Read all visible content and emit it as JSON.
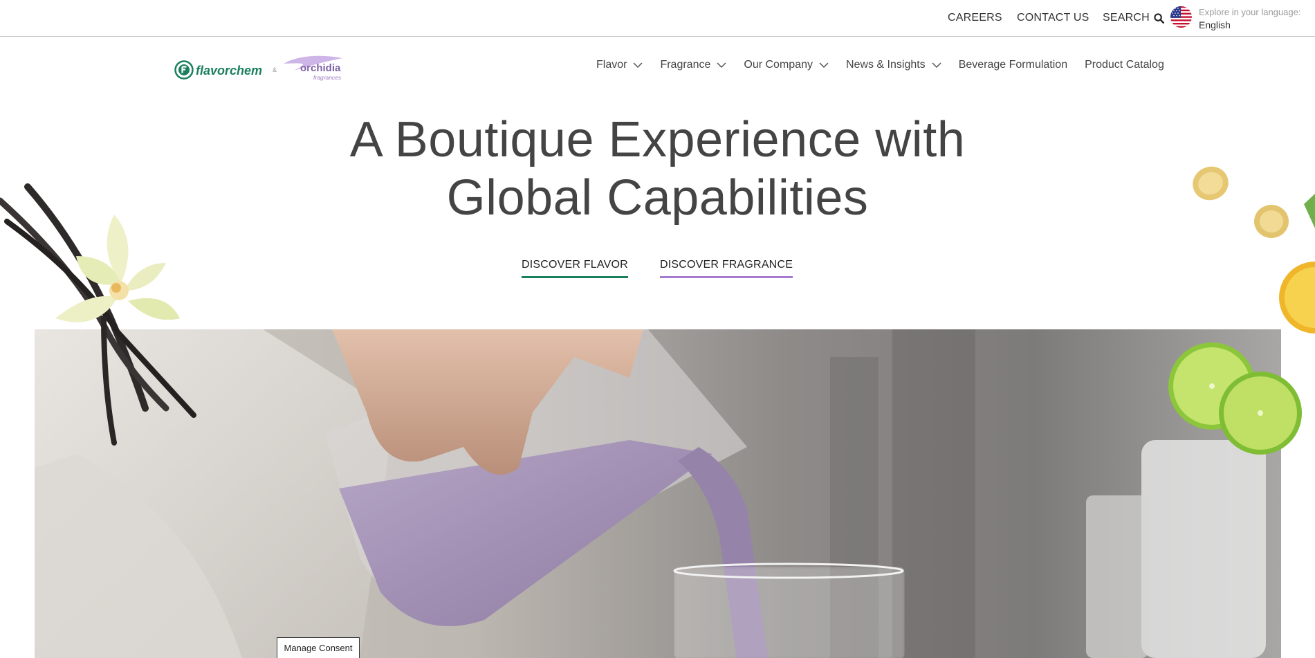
{
  "utility": {
    "careers": "CAREERS",
    "contact": "CONTACT US",
    "search": "SEARCH",
    "language_prompt": "Explore in your language:",
    "language_value": "English"
  },
  "logo": {
    "brand1": "flavorchem",
    "amp": "&",
    "brand2": "orchidia",
    "brand2_sub": "fragrances"
  },
  "nav": {
    "items": [
      {
        "label": "Flavor",
        "dropdown": true
      },
      {
        "label": "Fragrance",
        "dropdown": true
      },
      {
        "label": "Our Company",
        "dropdown": true
      },
      {
        "label": "News & Insights",
        "dropdown": true
      },
      {
        "label": "Beverage Formulation",
        "dropdown": false
      },
      {
        "label": "Product Catalog",
        "dropdown": false
      }
    ]
  },
  "hero": {
    "title_line1": "A Boutique Experience with",
    "title_line2": "Global Capabilities",
    "cta_flavor": "DISCOVER FLAVOR",
    "cta_fragrance": "DISCOVER FRAGRANCE"
  },
  "consent": {
    "label": "Manage Consent"
  },
  "colors": {
    "flavor_green": "#1b7f5e",
    "fragrance_purple": "#a57ad0",
    "text_dark": "#444444"
  }
}
